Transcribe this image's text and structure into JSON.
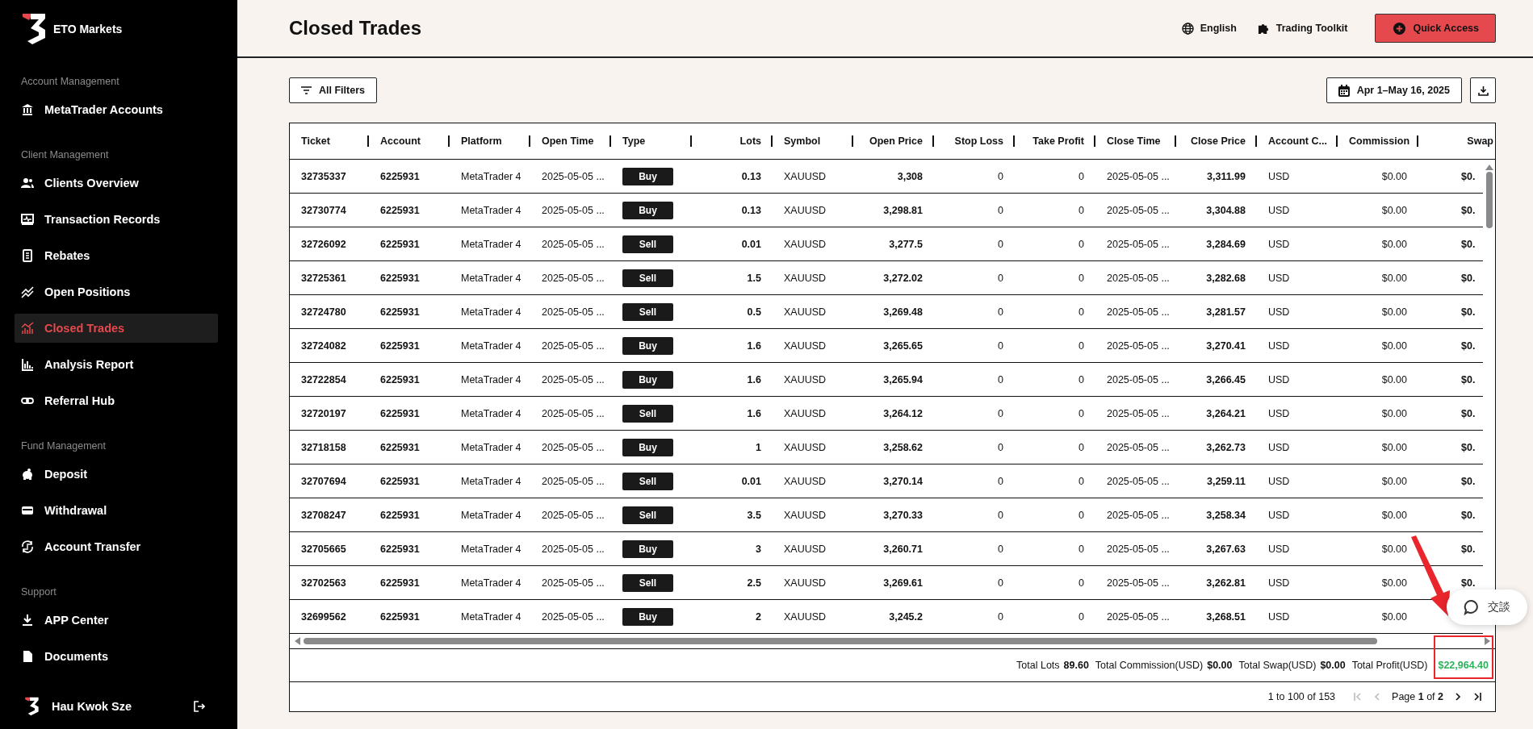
{
  "brand": {
    "name": "ETO Markets"
  },
  "sidebar": {
    "sections": [
      {
        "title": "Account Management",
        "items": [
          {
            "label": "MetaTrader Accounts",
            "selected": false
          }
        ]
      },
      {
        "title": "Client Management",
        "items": [
          {
            "label": "Clients Overview",
            "selected": false
          },
          {
            "label": "Transaction Records",
            "selected": false
          },
          {
            "label": "Rebates",
            "selected": false
          },
          {
            "label": "Open Positions",
            "selected": false
          },
          {
            "label": "Closed Trades",
            "selected": true
          },
          {
            "label": "Analysis Report",
            "selected": false
          },
          {
            "label": "Referral Hub",
            "selected": false
          }
        ]
      },
      {
        "title": "Fund Management",
        "items": [
          {
            "label": "Deposit",
            "selected": false
          },
          {
            "label": "Withdrawal",
            "selected": false
          },
          {
            "label": "Account Transfer",
            "selected": false
          }
        ]
      },
      {
        "title": "Support",
        "items": [
          {
            "label": "APP Center",
            "selected": false
          },
          {
            "label": "Documents",
            "selected": false
          }
        ]
      }
    ]
  },
  "user": {
    "name": "Hau Kwok Sze"
  },
  "header": {
    "title": "Closed Trades",
    "language": "English",
    "toolkit": "Trading Toolkit",
    "quick_access": "Quick Access"
  },
  "toolbar": {
    "filters": "All Filters",
    "date_range": "Apr 1–May 16, 2025"
  },
  "table": {
    "columns": [
      "Ticket",
      "Account",
      "Platform",
      "Open Time",
      "Type",
      "Lots",
      "Symbol",
      "Open Price",
      "Stop Loss",
      "Take Profit",
      "Close Time",
      "Close Price",
      "Account C...",
      "Commission",
      "Swap"
    ],
    "rows": [
      [
        "32735337",
        "6225931",
        "MetaTrader 4",
        "2025-05-05 ...",
        "Buy",
        "0.13",
        "XAUUSD",
        "3,308",
        "0",
        "0",
        "2025-05-05 ...",
        "3,311.99",
        "USD",
        "$0.00",
        "$0."
      ],
      [
        "32730774",
        "6225931",
        "MetaTrader 4",
        "2025-05-05 ...",
        "Buy",
        "0.13",
        "XAUUSD",
        "3,298.81",
        "0",
        "0",
        "2025-05-05 ...",
        "3,304.88",
        "USD",
        "$0.00",
        "$0."
      ],
      [
        "32726092",
        "6225931",
        "MetaTrader 4",
        "2025-05-05 ...",
        "Sell",
        "0.01",
        "XAUUSD",
        "3,277.5",
        "0",
        "0",
        "2025-05-05 ...",
        "3,284.69",
        "USD",
        "$0.00",
        "$0."
      ],
      [
        "32725361",
        "6225931",
        "MetaTrader 4",
        "2025-05-05 ...",
        "Sell",
        "1.5",
        "XAUUSD",
        "3,272.02",
        "0",
        "0",
        "2025-05-05 ...",
        "3,282.68",
        "USD",
        "$0.00",
        "$0."
      ],
      [
        "32724780",
        "6225931",
        "MetaTrader 4",
        "2025-05-05 ...",
        "Sell",
        "0.5",
        "XAUUSD",
        "3,269.48",
        "0",
        "0",
        "2025-05-05 ...",
        "3,281.57",
        "USD",
        "$0.00",
        "$0."
      ],
      [
        "32724082",
        "6225931",
        "MetaTrader 4",
        "2025-05-05 ...",
        "Buy",
        "1.6",
        "XAUUSD",
        "3,265.65",
        "0",
        "0",
        "2025-05-05 ...",
        "3,270.41",
        "USD",
        "$0.00",
        "$0."
      ],
      [
        "32722854",
        "6225931",
        "MetaTrader 4",
        "2025-05-05 ...",
        "Buy",
        "1.6",
        "XAUUSD",
        "3,265.94",
        "0",
        "0",
        "2025-05-05 ...",
        "3,266.45",
        "USD",
        "$0.00",
        "$0."
      ],
      [
        "32720197",
        "6225931",
        "MetaTrader 4",
        "2025-05-05 ...",
        "Sell",
        "1.6",
        "XAUUSD",
        "3,264.12",
        "0",
        "0",
        "2025-05-05 ...",
        "3,264.21",
        "USD",
        "$0.00",
        "$0."
      ],
      [
        "32718158",
        "6225931",
        "MetaTrader 4",
        "2025-05-05 ...",
        "Buy",
        "1",
        "XAUUSD",
        "3,258.62",
        "0",
        "0",
        "2025-05-05 ...",
        "3,262.73",
        "USD",
        "$0.00",
        "$0."
      ],
      [
        "32707694",
        "6225931",
        "MetaTrader 4",
        "2025-05-05 ...",
        "Sell",
        "0.01",
        "XAUUSD",
        "3,270.14",
        "0",
        "0",
        "2025-05-05 ...",
        "3,259.11",
        "USD",
        "$0.00",
        "$0."
      ],
      [
        "32708247",
        "6225931",
        "MetaTrader 4",
        "2025-05-05 ...",
        "Sell",
        "3.5",
        "XAUUSD",
        "3,270.33",
        "0",
        "0",
        "2025-05-05 ...",
        "3,258.34",
        "USD",
        "$0.00",
        "$0."
      ],
      [
        "32705665",
        "6225931",
        "MetaTrader 4",
        "2025-05-05 ...",
        "Buy",
        "3",
        "XAUUSD",
        "3,260.71",
        "0",
        "0",
        "2025-05-05 ...",
        "3,267.63",
        "USD",
        "$0.00",
        "$0."
      ],
      [
        "32702563",
        "6225931",
        "MetaTrader 4",
        "2025-05-05 ...",
        "Sell",
        "2.5",
        "XAUUSD",
        "3,269.61",
        "0",
        "0",
        "2025-05-05 ...",
        "3,262.81",
        "USD",
        "$0.00",
        "$0."
      ],
      [
        "32699562",
        "6225931",
        "MetaTrader 4",
        "2025-05-05 ...",
        "Buy",
        "2",
        "XAUUSD",
        "3,245.2",
        "0",
        "0",
        "2025-05-05 ...",
        "3,268.51",
        "USD",
        "$0.00"
      ]
    ]
  },
  "totals": [
    {
      "label": "Total Lots",
      "value": "89.60",
      "kind": "plain"
    },
    {
      "label": "Total Commission(USD)",
      "value": "$0.00",
      "kind": "plain"
    },
    {
      "label": "Total Swap(USD)",
      "value": "$0.00",
      "kind": "plain"
    },
    {
      "label": "Total Profit(USD)",
      "value": "$22,964.40",
      "kind": "profit"
    }
  ],
  "pagination": {
    "range": "1 to 100 of 153",
    "page": "Page **1** of **2**",
    "buttons": [
      {
        "kind": "first",
        "disabled": true
      },
      {
        "kind": "prev",
        "disabled": true
      },
      {
        "kind": "next",
        "disabled": false
      },
      {
        "kind": "last",
        "disabled": false
      }
    ]
  },
  "chat": {
    "label": "交談"
  }
}
